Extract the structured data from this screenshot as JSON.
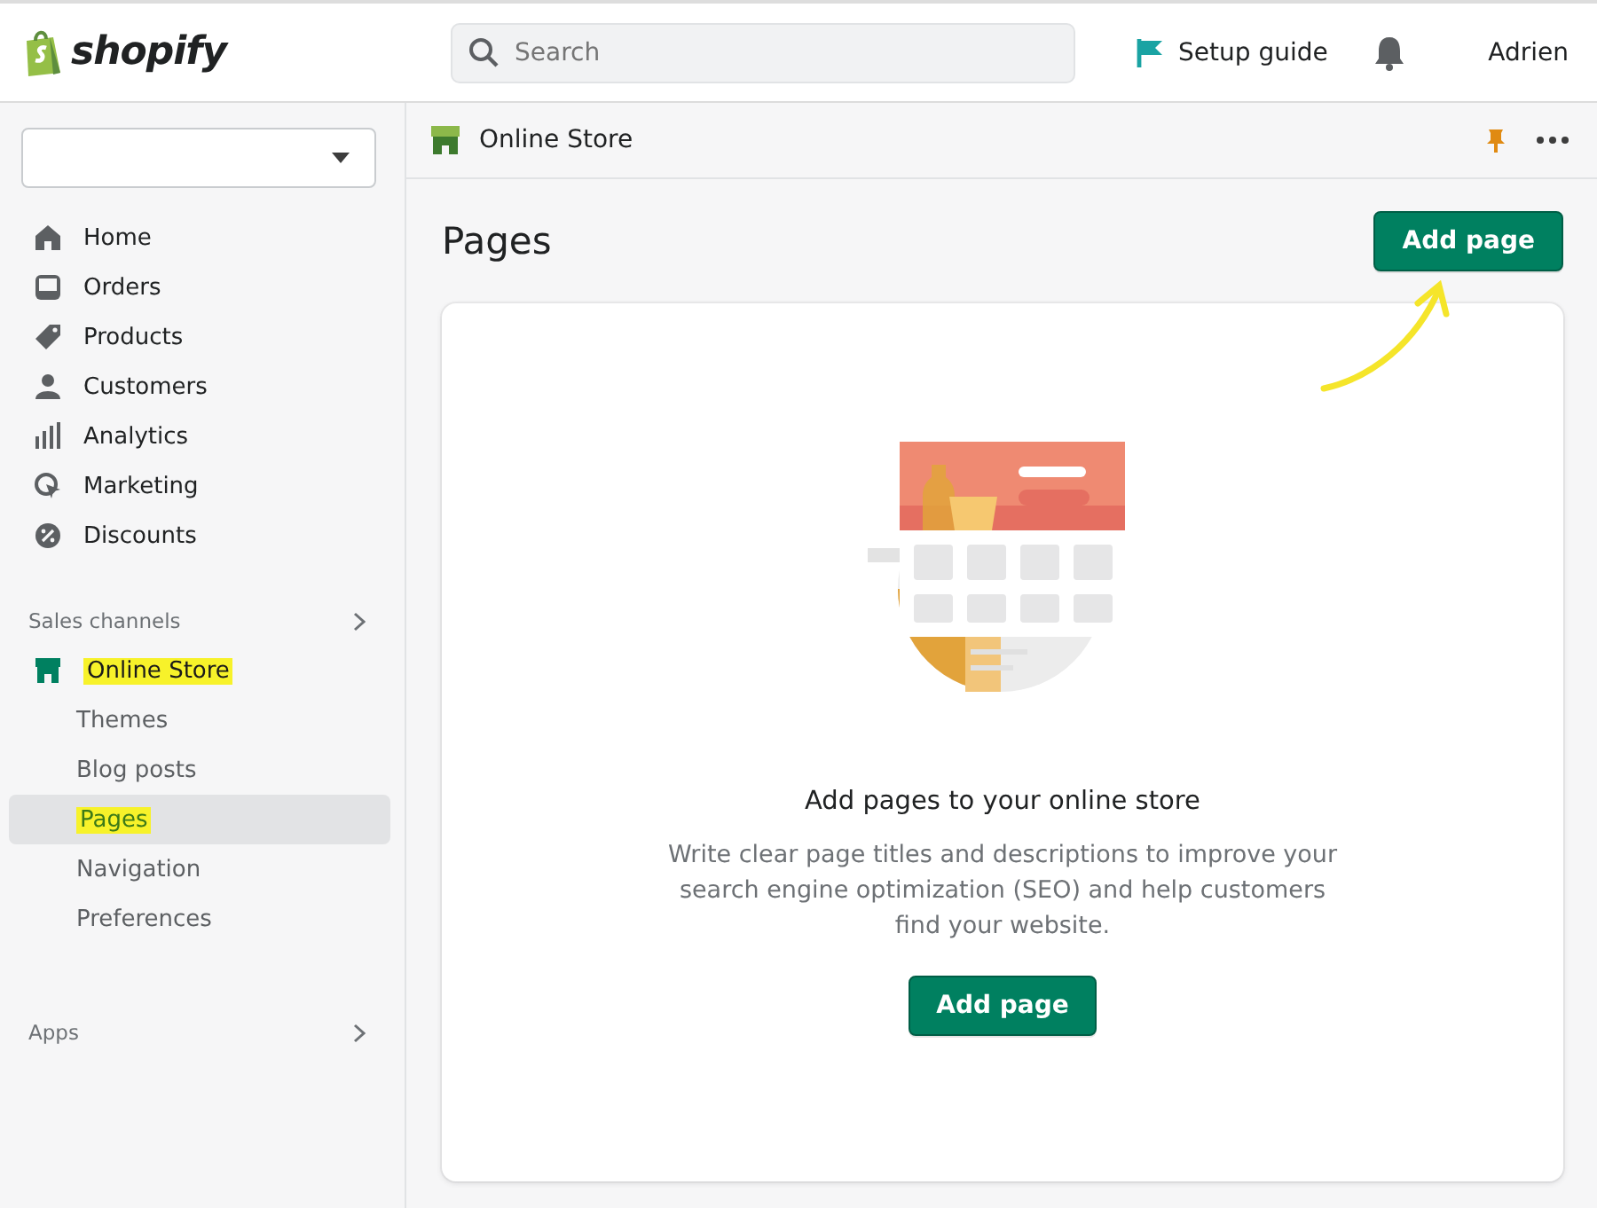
{
  "topbar": {
    "logo": "shopify",
    "search": {
      "placeholder": "Search"
    },
    "setup_guide": "Setup guide",
    "user": "Adrien"
  },
  "sidebar": {
    "items": [
      {
        "label": "Home",
        "selected": false
      },
      {
        "label": "Orders",
        "selected": false
      },
      {
        "label": "Products",
        "selected": false
      },
      {
        "label": "Customers",
        "selected": false
      },
      {
        "label": "Analytics",
        "selected": false
      },
      {
        "label": "Marketing",
        "selected": false
      },
      {
        "label": "Discounts",
        "selected": false
      }
    ],
    "sales_channels": {
      "label": "Sales channels",
      "channel": {
        "label": "Online Store",
        "highlighted": true
      },
      "children": [
        {
          "label": "Themes",
          "selected": false,
          "highlighted": false
        },
        {
          "label": "Blog posts",
          "selected": false,
          "highlighted": false
        },
        {
          "label": "Pages",
          "selected": true,
          "highlighted": true
        },
        {
          "label": "Navigation",
          "selected": false,
          "highlighted": false
        },
        {
          "label": "Preferences",
          "selected": false,
          "highlighted": false
        }
      ]
    },
    "apps": {
      "label": "Apps"
    }
  },
  "breadcrumb": {
    "title": "Online Store"
  },
  "page": {
    "title": "Pages",
    "primary_button": "Add page",
    "annotation_arrow": true,
    "empty_state": {
      "heading": "Add pages to your online store",
      "text": "Write clear page titles and descriptions to improve your search engine optimization (SEO) and help customers find your website.",
      "button": "Add page"
    }
  }
}
